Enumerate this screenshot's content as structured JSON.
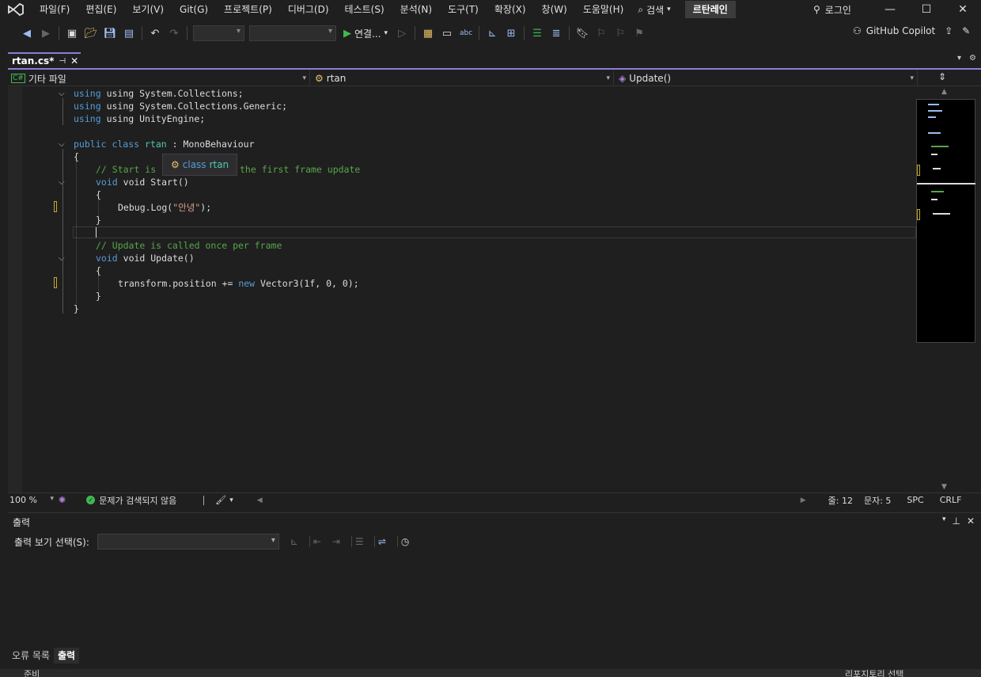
{
  "menu": {
    "items": [
      "파일(F)",
      "편집(E)",
      "보기(V)",
      "Git(G)",
      "프로젝트(P)",
      "디버그(D)",
      "테스트(S)",
      "분석(N)",
      "도구(T)",
      "확장(X)",
      "창(W)",
      "도움말(H)"
    ],
    "search_label": "검색",
    "solution_name": "르탄레인",
    "login_label": "로그인"
  },
  "toolbar": {
    "run_label": "연결...",
    "copilot_label": "GitHub Copilot"
  },
  "tab": {
    "title": "rtan.cs*"
  },
  "navbar": {
    "project": "기타 파일",
    "class": "rtan",
    "member": "Update()"
  },
  "code": {
    "line1": "using System.Collections;",
    "line2": "using System.Collections.Generic;",
    "line3": "using UnityEngine;",
    "class_kw": "public class",
    "class_name": "rtan",
    "class_base": " : MonoBehaviour",
    "brace_open": "{",
    "comment1_a": "// Start is",
    "comment1_b": "the first frame update",
    "start_sig": "void Start()",
    "debug_a": "Debug.Log(",
    "debug_str": "\"안녕\"",
    "debug_b": ");",
    "brace_close": "}",
    "comment2": "// Update is called once per frame",
    "update_sig": "void Update()",
    "transform_a": "transform.position += ",
    "new_kw": "new",
    "transform_b": " Vector3(1f, 0, 0);",
    "tooltip_kw": "class",
    "tooltip_name": "rtan"
  },
  "editor_status": {
    "zoom": "100 %",
    "issues": "문제가 검색되지 않음",
    "line": "줄: 12",
    "col": "문자: 5",
    "whitespace": "SPC",
    "eol": "CRLF"
  },
  "output": {
    "title": "출력",
    "source_label": "출력 보기 선택(S):",
    "source_value": ""
  },
  "bottom_tabs": [
    "오류 목록",
    "출력"
  ],
  "statusbar": {
    "ready": "준비",
    "repo": "리포지토리 선택"
  }
}
